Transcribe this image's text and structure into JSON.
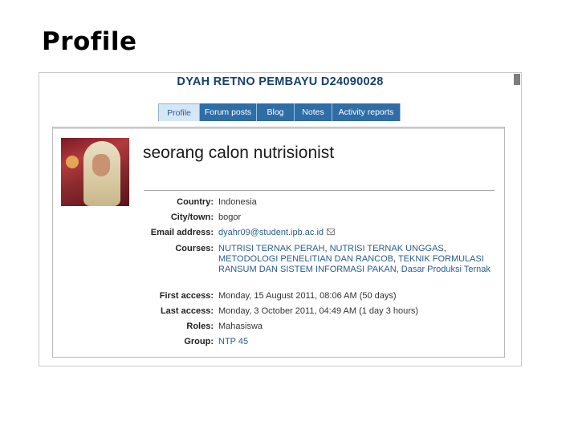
{
  "slide": {
    "title": "Profile"
  },
  "profile": {
    "name": "DYAH RETNO PEMBAYU D24090028",
    "tabs": [
      {
        "label": "Profile",
        "active": true
      },
      {
        "label": "Forum posts",
        "active": false
      },
      {
        "label": "Blog",
        "active": false
      },
      {
        "label": "Notes",
        "active": false
      },
      {
        "label": "Activity reports",
        "active": false
      }
    ],
    "description": "seorang calon nutrisionist",
    "fields": {
      "country": {
        "label": "Country:",
        "value": "Indonesia"
      },
      "city": {
        "label": "City/town:",
        "value": "bogor"
      },
      "email": {
        "label": "Email address:",
        "value": "dyahr09@student.ipb.ac.id"
      },
      "courses": {
        "label": "Courses:",
        "items": [
          "NUTRISI TERNAK PERAH",
          "NUTRISI TERNAK UNGGAS",
          "METODOLOGI PENELITIAN DAN RANCOB",
          "TEKNIK FORMULASI RANSUM DAN SISTEM INFORMASI PAKAN",
          "Dasar Produksi Ternak"
        ]
      },
      "first_access": {
        "label": "First access:",
        "value": "Monday, 15 August 2011, 08:06 AM  (50 days)"
      },
      "last_access": {
        "label": "Last access:",
        "value": "Monday, 3 October 2011, 04:49 AM  (1 day 3 hours)"
      },
      "roles": {
        "label": "Roles:",
        "value": "Mahasiswa"
      },
      "group": {
        "label": "Group:",
        "value": "NTP 45"
      }
    },
    "colors": {
      "tab": "#2f6da6",
      "name": "#14406e",
      "link": "#2a5d8f"
    },
    "icons": [
      "mail-icon"
    ]
  }
}
